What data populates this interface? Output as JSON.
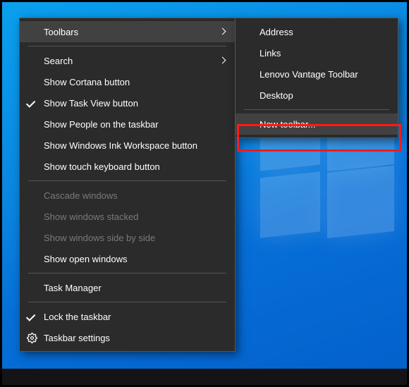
{
  "primaryMenu": {
    "items": [
      {
        "label": "Toolbars",
        "submenu": true,
        "hovered": true
      },
      {
        "sep": true
      },
      {
        "label": "Search",
        "submenu": true
      },
      {
        "label": "Show Cortana button"
      },
      {
        "label": "Show Task View button",
        "checked": true
      },
      {
        "label": "Show People on the taskbar"
      },
      {
        "label": "Show Windows Ink Workspace button"
      },
      {
        "label": "Show touch keyboard button"
      },
      {
        "sep": true
      },
      {
        "label": "Cascade windows",
        "disabled": true
      },
      {
        "label": "Show windows stacked",
        "disabled": true
      },
      {
        "label": "Show windows side by side",
        "disabled": true
      },
      {
        "label": "Show open windows"
      },
      {
        "sep": true
      },
      {
        "label": "Task Manager"
      },
      {
        "sep": true
      },
      {
        "label": "Lock the taskbar",
        "checked": true
      },
      {
        "label": "Taskbar settings",
        "icon": "gear"
      }
    ]
  },
  "subMenu": {
    "items": [
      {
        "label": "Address"
      },
      {
        "label": "Links"
      },
      {
        "label": "Lenovo Vantage Toolbar"
      },
      {
        "label": "Desktop"
      },
      {
        "sep": true
      },
      {
        "label": "New toolbar...",
        "highlighted": true,
        "hovered": true
      }
    ]
  }
}
